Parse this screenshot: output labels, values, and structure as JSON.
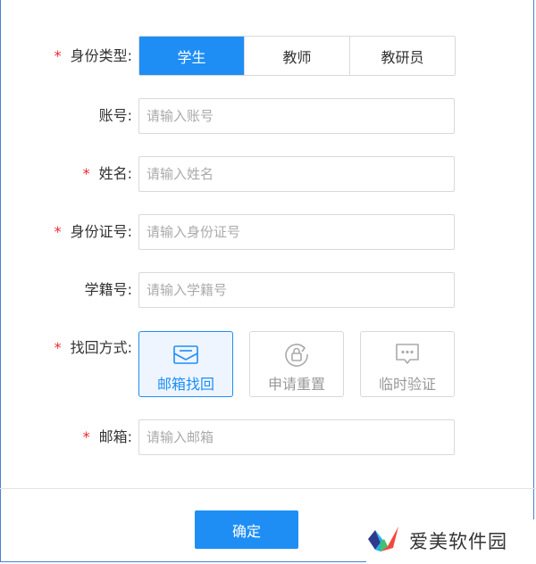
{
  "form": {
    "identity": {
      "label": "身份类型:",
      "options": [
        "学生",
        "教师",
        "教研员"
      ],
      "selected": "学生"
    },
    "account": {
      "label": "账号:",
      "placeholder": "请输入账号"
    },
    "name": {
      "label": "姓名:",
      "placeholder": "请输入姓名"
    },
    "id_number": {
      "label": "身份证号:",
      "placeholder": "请输入身份证号"
    },
    "student_number": {
      "label": "学籍号:",
      "placeholder": "请输入学籍号"
    },
    "recovery": {
      "label": "找回方式:",
      "options": [
        {
          "label": "邮箱找回",
          "icon": "mail-icon"
        },
        {
          "label": "申请重置",
          "icon": "lock-reset-icon"
        },
        {
          "label": "临时验证",
          "icon": "chat-dots-icon"
        }
      ],
      "selected": "邮箱找回"
    },
    "email": {
      "label": "邮箱:",
      "placeholder": "请输入邮箱"
    },
    "required_mark": "*",
    "confirm_label": "确定"
  },
  "watermark": {
    "text": "爱美软件园"
  },
  "colors": {
    "primary": "#1e8ef5",
    "required": "#f5222d",
    "border": "#d9d9d9",
    "placeholder": "#aaaaaa",
    "selected_bg": "#eef5fe"
  }
}
